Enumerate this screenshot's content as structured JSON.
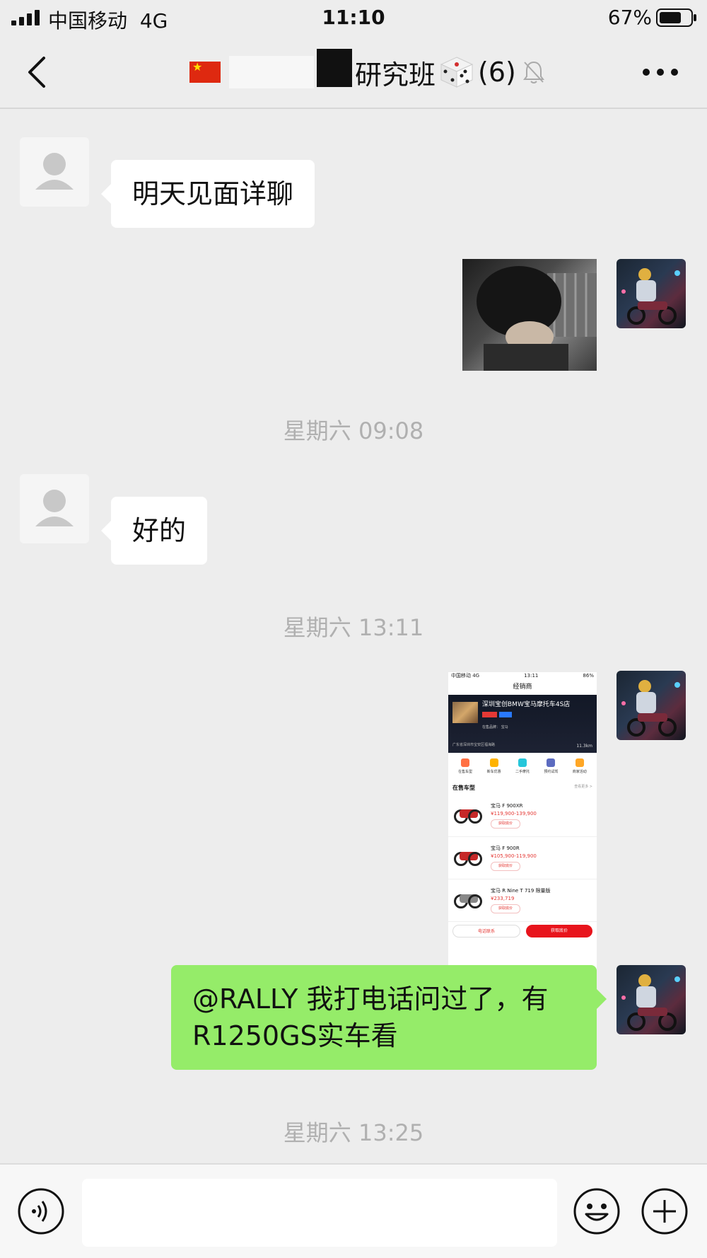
{
  "status_bar": {
    "carrier": "中国移动",
    "network": "4G",
    "time": "11:10",
    "battery_percent": "67%"
  },
  "header": {
    "title_text": "研究班",
    "member_count": "(6)",
    "icons": [
      "china-flag-icon",
      "dice-icon",
      "mute-bell-icon",
      "more-icon",
      "back-icon"
    ]
  },
  "messages": [
    {
      "side": "left",
      "type": "text",
      "text": "明天见面详聊"
    },
    {
      "side": "right",
      "type": "image",
      "image": "sticker-photo"
    },
    {
      "type": "timestamp",
      "text": "星期六 09:08"
    },
    {
      "side": "left",
      "type": "text",
      "text": "好的"
    },
    {
      "type": "timestamp",
      "text": "星期六 13:11"
    },
    {
      "side": "right",
      "type": "image",
      "image": "dealer-app-screenshot"
    },
    {
      "side": "right",
      "type": "text",
      "text": "@RALLY 我打电话问过了，有R1250GS实车看"
    },
    {
      "type": "timestamp",
      "text": "星期六 13:25"
    }
  ],
  "shot": {
    "status_left": "中国移动  4G",
    "status_time": "13:11",
    "status_right": "86%",
    "title": "经销商",
    "store_name": "深圳宝创BMW宝马摩托车4S店",
    "brand_line": "在售品牌：  宝马",
    "address": "广东省深圳市宝安区福海路",
    "distance": "11.3km",
    "icons": [
      {
        "label": "在售车型",
        "color": "#ff7043"
      },
      {
        "label": "新车优惠",
        "color": "#ffb300"
      },
      {
        "label": "二手摩托",
        "color": "#26c6da"
      },
      {
        "label": "预约试驾",
        "color": "#5c6bc0"
      },
      {
        "label": "商家活动",
        "color": "#ffa726"
      }
    ],
    "section_title": "在售车型",
    "section_more": "查看更多 >",
    "items": [
      {
        "name": "宝马 F 900XR",
        "price": "¥119,900-139,900",
        "button": "获取底价"
      },
      {
        "name": "宝马 F 900R",
        "price": "¥105,900-119,900",
        "button": "获取底价"
      },
      {
        "name": "宝马 R Nine T 719 限量版",
        "price": "¥233,719",
        "button": "获取底价"
      }
    ],
    "call_label": "电话联系",
    "get_price_label": "获取底价"
  },
  "input_bar": {
    "placeholder": "",
    "icons": [
      "voice-icon",
      "emoji-icon",
      "plus-icon"
    ]
  },
  "colors": {
    "background": "#ededed",
    "self_bubble": "#95ec69",
    "other_bubble": "#ffffff",
    "timestamp": "#b0b0b0"
  }
}
